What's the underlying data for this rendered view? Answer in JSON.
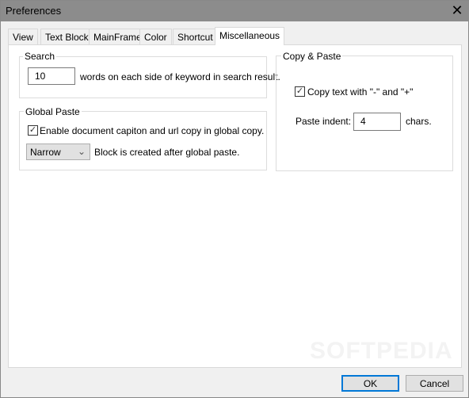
{
  "window": {
    "title": "Preferences"
  },
  "tabs": [
    "View",
    "Text Block",
    "MainFrame",
    "Color",
    "Shortcut",
    "Miscellaneous"
  ],
  "search": {
    "label": "Search",
    "value": "10",
    "suffix": "words on each side of keyword in search result."
  },
  "global_paste": {
    "label": "Global Paste",
    "checkbox_label": "Enable document capiton and url copy in global copy.",
    "checked": true,
    "select_value": "Narrow",
    "select_suffix": "Block is created after global paste."
  },
  "copy_paste": {
    "label": "Copy & Paste",
    "checkbox_label": "Copy text with \"-\" and \"+\"",
    "checked": true,
    "indent_label": "Paste indent:",
    "indent_value": "4",
    "indent_suffix": "chars."
  },
  "buttons": {
    "ok": "OK",
    "cancel": "Cancel"
  },
  "watermark": "SOFTPEDIA"
}
